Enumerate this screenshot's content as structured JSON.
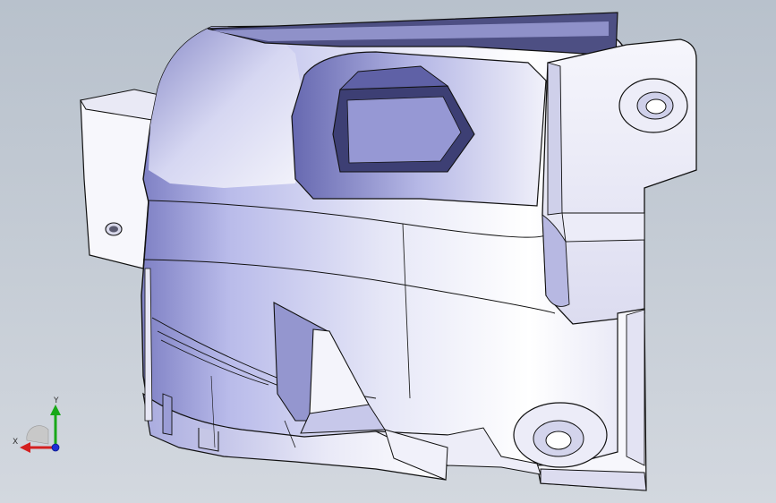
{
  "viewport": {
    "background_top": "#b8c1cc",
    "background_bottom": "#d3d8df"
  },
  "model": {
    "shading_color": "#c9cbef",
    "edge_color": "#111111"
  },
  "triad": {
    "x_label": "X",
    "y_label": "Y",
    "x_color": "#d42020",
    "y_color": "#18a818",
    "z_color": "#1f2fd6"
  }
}
